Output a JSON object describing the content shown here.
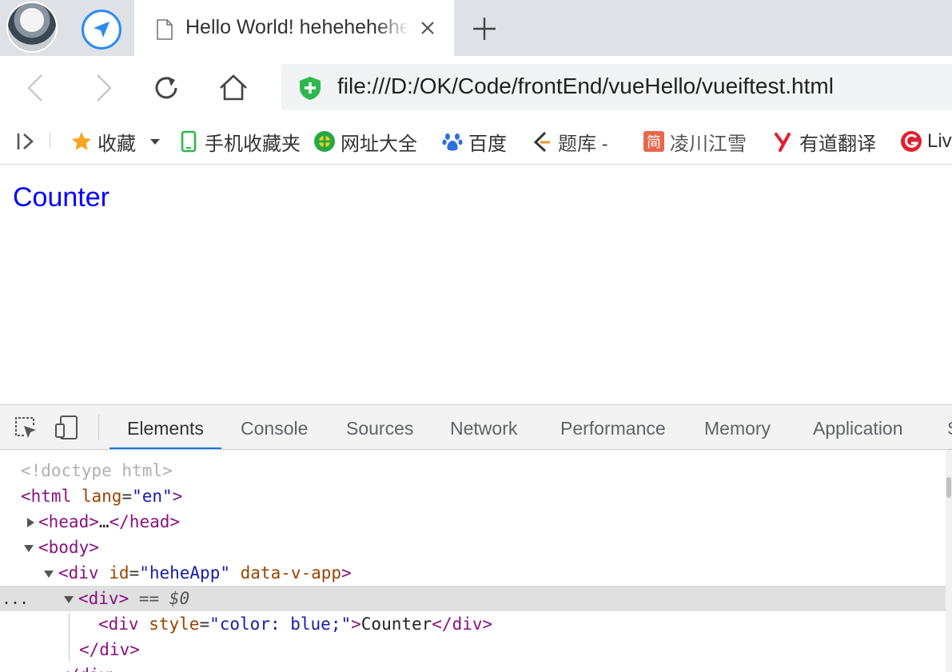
{
  "browser": {
    "tab": {
      "title": "Hello World! hehehehehe"
    },
    "address": {
      "url": "file:///D:/OK/Code/frontEnd/vueHello/vueiftest.html"
    },
    "bookmarks": [
      {
        "label": "收藏",
        "icon": "star-icon",
        "color": "#f5a623"
      },
      {
        "label": "手机收藏夹",
        "icon": "phone-icon",
        "color": "#2db84d"
      },
      {
        "label": "网址大全",
        "icon": "site-nav-icon",
        "color": "#27a844"
      },
      {
        "label": "百度",
        "icon": "baidu-paw-icon",
        "color": "#2f6fe0"
      },
      {
        "label": "题库 -",
        "icon": "tiku-icon",
        "color": "#e89b2e"
      },
      {
        "label": "凌川江雪",
        "icon": "jianshu-icon",
        "color": "#e9664c"
      },
      {
        "label": "有道翻译",
        "icon": "youdao-icon",
        "color": "#e0202f"
      },
      {
        "label": "Liv",
        "icon": "livemp-icon",
        "color": "#e0202f"
      }
    ]
  },
  "page": {
    "counter_text": "Counter",
    "counter_color": "blue"
  },
  "devtools": {
    "tabs": [
      "Elements",
      "Console",
      "Sources",
      "Network",
      "Performance",
      "Memory",
      "Application",
      "S"
    ],
    "active_tab": "Elements",
    "dom": {
      "doctype": "<!doctype html>",
      "html_open": "<html",
      "html_attr_name": "lang",
      "html_attr_value": "\"en\"",
      "head_open": "<head>",
      "ellipsis": "…",
      "head_close": "</head>",
      "body_open": "<body>",
      "div_open": "<div",
      "id_attr": "id",
      "id_value": "\"heheApp\"",
      "vapp_attr": "data-v-app",
      "gt": ">",
      "selected_div": "<div>",
      "selected_marker": "== $0",
      "inner_attr": "style",
      "inner_value": "\"color: blue;\"",
      "inner_text": "Counter",
      "div_close": "</div>",
      "more_dots": "..."
    }
  }
}
